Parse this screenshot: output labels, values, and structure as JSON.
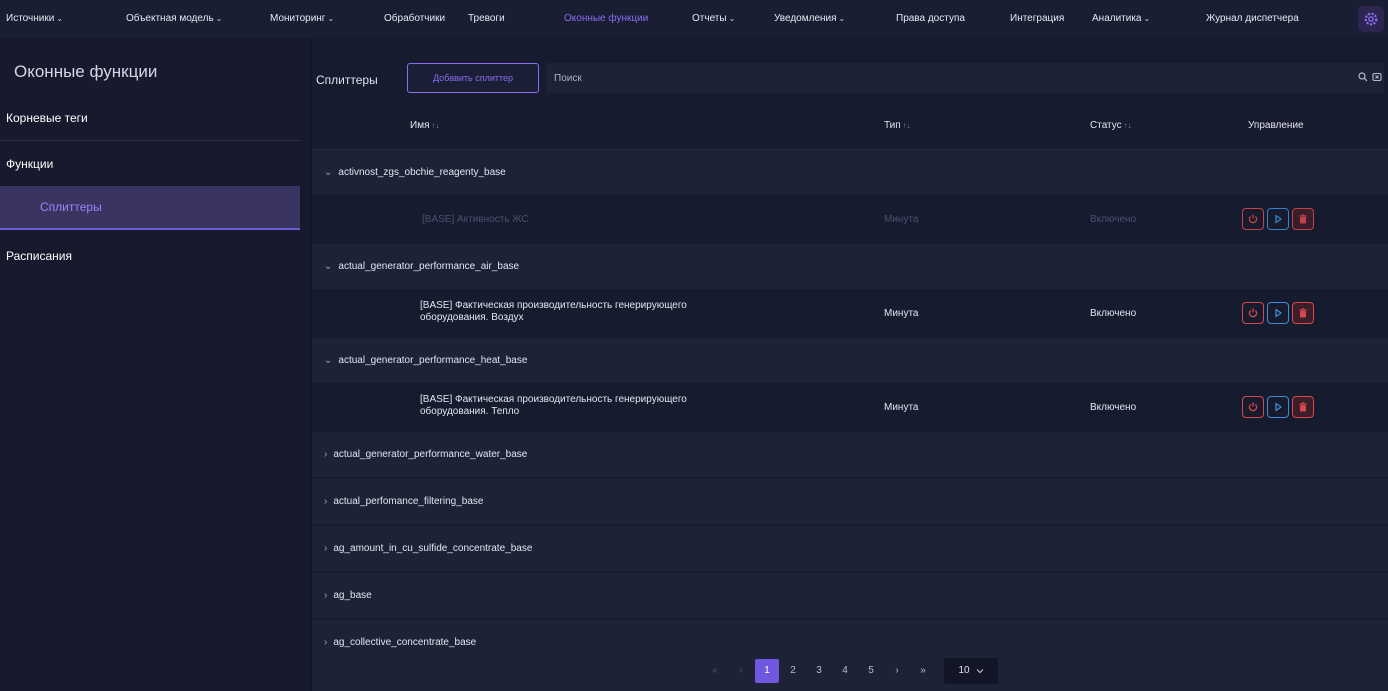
{
  "nav": {
    "items": [
      {
        "label": "Источники",
        "dropdown": true
      },
      {
        "label": "Объектная модель",
        "dropdown": true
      },
      {
        "label": "Мониторинг",
        "dropdown": true
      },
      {
        "label": "Обработчики",
        "dropdown": false
      },
      {
        "label": "Тревоги",
        "dropdown": false
      },
      {
        "label": "Оконные функции",
        "dropdown": false,
        "active": true
      },
      {
        "label": "Отчеты",
        "dropdown": true
      },
      {
        "label": "Уведомления",
        "dropdown": true
      },
      {
        "label": "Права доступа",
        "dropdown": false
      },
      {
        "label": "Интеграция",
        "dropdown": false
      },
      {
        "label": "Аналитика",
        "dropdown": true
      },
      {
        "label": "Журнал диспетчера",
        "dropdown": false
      }
    ],
    "settings_icon": "gear-icon"
  },
  "sidebar": {
    "title": "Оконные функции",
    "items": [
      {
        "label": "Корневые теги"
      },
      {
        "label": "Функции"
      },
      {
        "label": "Сплиттеры",
        "selected": true
      },
      {
        "label": "Расписания"
      }
    ]
  },
  "toolbar": {
    "label": "Сплиттеры",
    "add_label": "Добавить сплиттер",
    "search_placeholder": "Поиск"
  },
  "table": {
    "headers": {
      "name": "Имя",
      "type": "Тип",
      "status": "Статус",
      "actions": "Управление"
    },
    "groups": [
      {
        "name": "activnost_zgs_obchie_reagenty_base",
        "expanded": true,
        "rows": [
          {
            "name": "[BASE] Активность ЖС",
            "type": "Минута",
            "status": "Включено",
            "disabled": true
          }
        ]
      },
      {
        "name": "actual_generator_performance_air_base",
        "expanded": true,
        "rows": [
          {
            "name": "[BASE] Фактическая производительность генерирующего оборудования. Воздух",
            "type": "Минута",
            "status": "Включено",
            "disabled": false
          }
        ]
      },
      {
        "name": "actual_generator_performance_heat_base",
        "expanded": true,
        "rows": [
          {
            "name": "[BASE] Фактическая производительность генерирующего оборудования. Тепло",
            "type": "Минута",
            "status": "Включено",
            "disabled": false
          }
        ]
      },
      {
        "name": "actual_generator_performance_water_base",
        "expanded": false,
        "rows": []
      },
      {
        "name": "actual_perfomance_filtering_base",
        "expanded": false,
        "rows": []
      },
      {
        "name": "ag_amount_in_cu_sulfide_concentrate_base",
        "expanded": false,
        "rows": []
      },
      {
        "name": "ag_base",
        "expanded": false,
        "rows": []
      },
      {
        "name": "ag_collective_concentrate_base",
        "expanded": false,
        "rows": []
      }
    ]
  },
  "pagination": {
    "first": "«",
    "prev": "‹",
    "pages": [
      "1",
      "2",
      "3",
      "4",
      "5"
    ],
    "current": "1",
    "next": "›",
    "last": "»",
    "page_size": "10"
  },
  "colors": {
    "accent": "#8a6df2",
    "danger": "#d8464e",
    "info": "#3c8dd9",
    "background": "#121626"
  }
}
